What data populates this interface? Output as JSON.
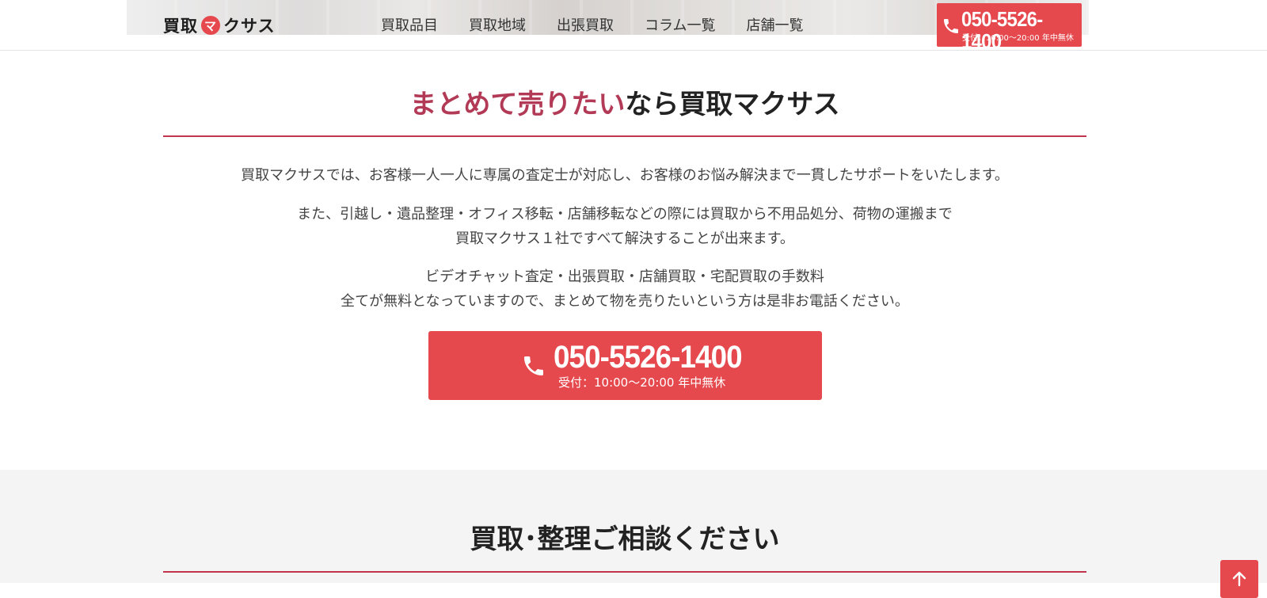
{
  "header": {
    "logo": {
      "text_before": "買取",
      "mark": "マ",
      "text_after": "クサス"
    },
    "nav": [
      {
        "label": "買取品目"
      },
      {
        "label": "買取地域"
      },
      {
        "label": "出張買取"
      },
      {
        "label": "コラム一覧"
      },
      {
        "label": "店舗一覧"
      }
    ],
    "tel": {
      "icon": "phone-icon",
      "number": "050-5526-1400",
      "hours": "受付：10:00〜20:00 年中無休"
    }
  },
  "intro": {
    "title_accent": "まとめて売りたい",
    "title_rest": "なら買取マクサス",
    "paragraph1": "買取マクサスでは、お客様一人一人に専属の査定士が対応し、お客様のお悩み解決まで一貫したサポートをいたします。",
    "paragraph2_line1": "また、引越し・遺品整理・オフィス移転・店舗移転などの際には買取から不用品処分、荷物の運搬まで",
    "paragraph2_line2": "買取マクサス１社ですべて解決することが出来ます。",
    "paragraph3_line1": "ビデオチャット査定・出張買取・店舗買取・宅配買取の手数料",
    "paragraph3_line2": "全てが無料となっていますので、まとめて物を売りたいという方は是非お電話ください。",
    "cta": {
      "icon": "phone-icon",
      "number": "050-5526-1400",
      "hours": "受付：10:00〜20:00 年中無休"
    }
  },
  "consult": {
    "title": "買取･整理ご相談ください"
  },
  "page_top": {
    "icon": "arrow-up-icon"
  },
  "colors": {
    "brand_red": "#e5484d",
    "title_accent": "#b23a56",
    "rule": "#c0344c",
    "gray_band": "#f4f4f4"
  }
}
